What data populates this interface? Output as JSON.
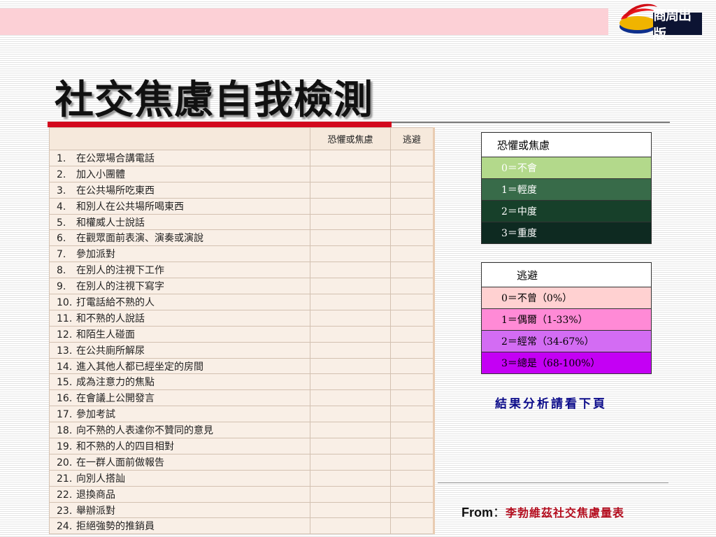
{
  "header": {
    "publisher": "商周出版"
  },
  "title": "社交焦慮自我檢測",
  "survey": {
    "columns": [
      "",
      "恐懼或焦慮",
      "逃避"
    ],
    "items": [
      {
        "num": "1.",
        "text": "在公眾場合講電話"
      },
      {
        "num": "2.",
        "text": "加入小團體"
      },
      {
        "num": "3.",
        "text": "在公共場所吃東西"
      },
      {
        "num": "4.",
        "text": "和別人在公共場所喝東西"
      },
      {
        "num": "5.",
        "text": "和權威人士說話"
      },
      {
        "num": "6.",
        "text": "在觀眾面前表演、演奏或演說"
      },
      {
        "num": "7.",
        "text": "參加派對"
      },
      {
        "num": "8.",
        "text": "在別人的注視下工作"
      },
      {
        "num": "9.",
        "text": "在別人的注視下寫字"
      },
      {
        "num": "10.",
        "text": "打電話給不熟的人"
      },
      {
        "num": "11.",
        "text": "和不熟的人說話"
      },
      {
        "num": "12.",
        "text": "和陌生人碰面"
      },
      {
        "num": "13.",
        "text": "在公共廁所解尿"
      },
      {
        "num": "14.",
        "text": "進入其他人都已經坐定的房間"
      },
      {
        "num": "15.",
        "text": "成為注意力的焦點"
      },
      {
        "num": "16.",
        "text": "在會議上公開發言"
      },
      {
        "num": "17.",
        "text": "參加考試"
      },
      {
        "num": "18.",
        "text": "向不熟的人表達你不贊同的意見"
      },
      {
        "num": "19.",
        "text": "和不熟的人的四目相對"
      },
      {
        "num": "20.",
        "text": "在一群人面前做報告"
      },
      {
        "num": "21.",
        "text": "向別人搭訕"
      },
      {
        "num": "22.",
        "text": "退換商品"
      },
      {
        "num": "23.",
        "text": "舉辦派對"
      },
      {
        "num": "24.",
        "text": "拒絕強勢的推銷員"
      }
    ]
  },
  "legend_fear": {
    "title": "恐懼或焦慮",
    "levels": [
      {
        "label": "0＝不會",
        "bg": "#b3d98b",
        "fg": "#ffffff"
      },
      {
        "label": "1＝輕度",
        "bg": "#386b49",
        "fg": "#ffffff"
      },
      {
        "label": "2＝中度",
        "bg": "#17402a",
        "fg": "#ffffff"
      },
      {
        "label": "3＝重度",
        "bg": "#0e2a21",
        "fg": "#ffffff"
      }
    ]
  },
  "legend_avoid": {
    "title": "逃避",
    "levels": [
      {
        "label": "0＝不曾（0%）",
        "bg": "#ffd1d1",
        "fg": "#000000"
      },
      {
        "label": "1＝偶爾（1-33%）",
        "bg": "#ff8ad6",
        "fg": "#000000"
      },
      {
        "label": "2＝經常（34-67%）",
        "bg": "#d36cf3",
        "fg": "#000000"
      },
      {
        "label": "3＝總是（68-100%）",
        "bg": "#c400f4",
        "fg": "#000000"
      }
    ]
  },
  "result_note": "結果分析請看下頁",
  "source": {
    "label": "From",
    "colon": "：",
    "name": "李勃維茲社交焦慮量表"
  },
  "colors": {
    "title_rule": "#d3081d",
    "band": "#fcd0d6",
    "note": "#0c0c8a",
    "source_name": "#b40d1e"
  }
}
